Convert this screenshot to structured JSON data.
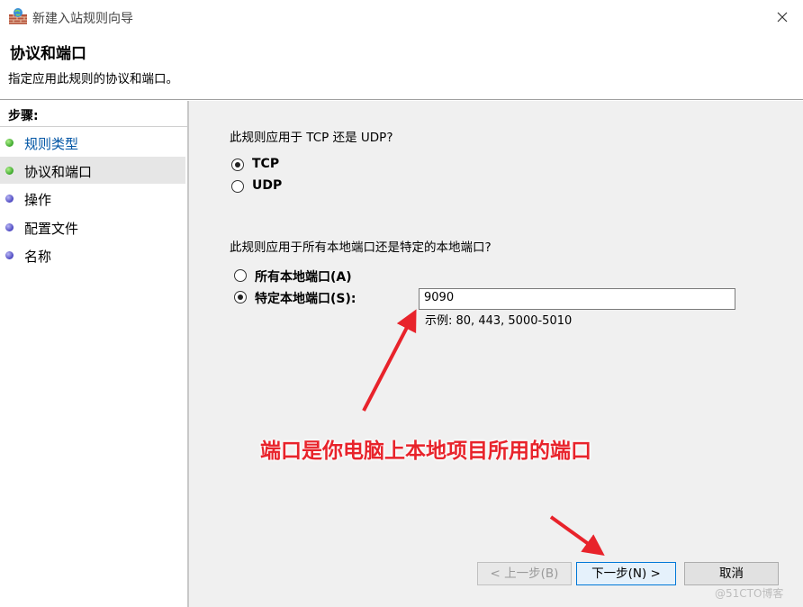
{
  "window": {
    "title": "新建入站规则向导"
  },
  "header": {
    "title": "协议和端口",
    "subtitle": "指定应用此规则的协议和端口。"
  },
  "steps": {
    "title": "步骤:",
    "items": [
      {
        "label": "规则类型",
        "state": "done"
      },
      {
        "label": "协议和端口",
        "state": "current"
      },
      {
        "label": "操作",
        "state": "pending"
      },
      {
        "label": "配置文件",
        "state": "pending"
      },
      {
        "label": "名称",
        "state": "pending"
      }
    ]
  },
  "protocol": {
    "question": "此规则应用于 TCP 还是 UDP?",
    "options": [
      {
        "label": "TCP",
        "checked": true
      },
      {
        "label": "UDP",
        "checked": false
      }
    ]
  },
  "ports": {
    "question": "此规则应用于所有本地端口还是特定的本地端口?",
    "options": [
      {
        "label": "所有本地端口(A)",
        "checked": false
      },
      {
        "label": "特定本地端口(S):",
        "checked": true
      }
    ],
    "value": "9090",
    "example": "示例: 80, 443, 5000-5010"
  },
  "annotation": {
    "text": "端口是你电脑上本地项目所用的端口",
    "color": "#e8232b"
  },
  "buttons": {
    "back": "< 上一步(B)",
    "next": "下一步(N) >",
    "cancel": "取消"
  },
  "watermark": "@51CTO博客",
  "colors": {
    "accent": "#0078d7",
    "step_done": "#3aa62a",
    "step_pending": "#4b46c0"
  }
}
